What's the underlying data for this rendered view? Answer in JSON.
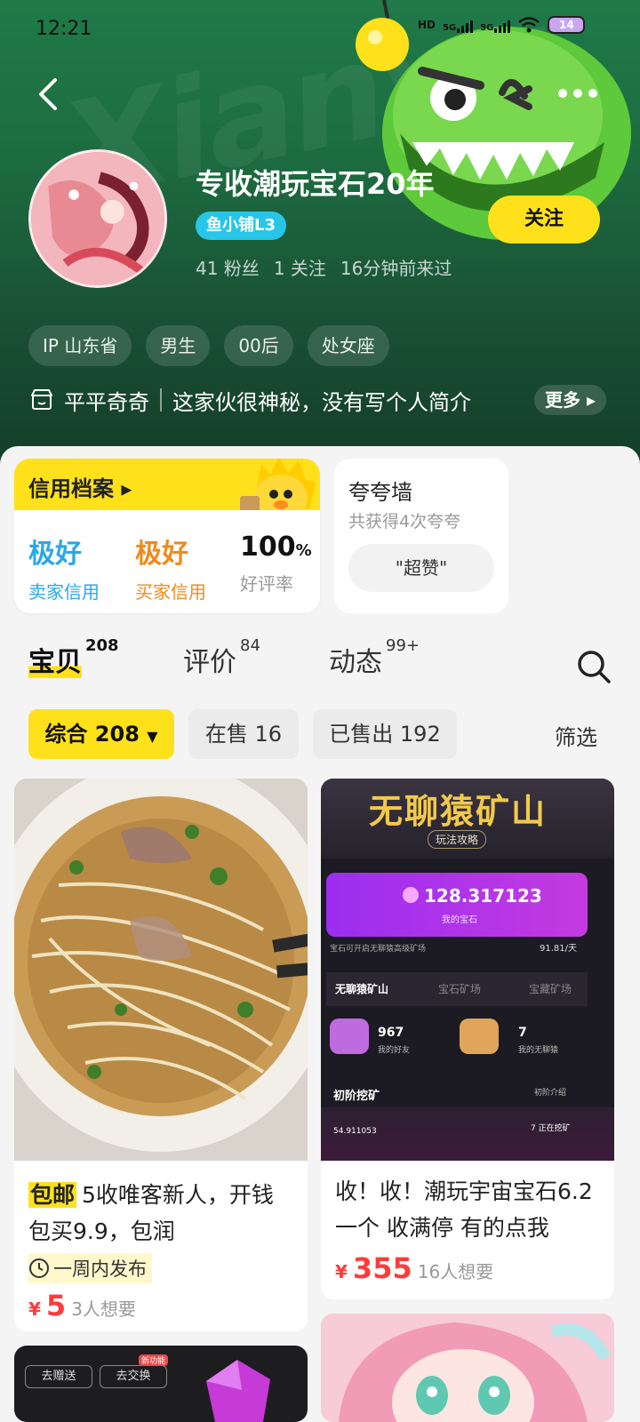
{
  "status_bar": {
    "time": "12:21",
    "battery": "14",
    "network": [
      "HD",
      "5G",
      "5G"
    ]
  },
  "header": {
    "shop_name": "专收潮玩宝石20年",
    "level_badge": "鱼小铺L3",
    "stats": {
      "fans": "41 粉丝",
      "following": "1 关注",
      "last_visit": "16分钟前来过"
    },
    "follow_label": "关注",
    "tags": [
      "IP 山东省",
      "男生",
      "00后",
      "处女座"
    ],
    "bio": {
      "nickname": "平平奇奇",
      "text": "这家伙很神秘，没有写个人简介",
      "more_label": "更多"
    }
  },
  "credit": {
    "title": "信用档案",
    "seller": {
      "value": "极好",
      "label": "卖家信用"
    },
    "buyer": {
      "value": "极好",
      "label": "买家信用"
    },
    "rating": {
      "value": "100",
      "unit": "%",
      "label": "好评率"
    }
  },
  "praise_wall": {
    "title": "夸夸墙",
    "subtitle": "共获得4次夸夸",
    "chip": "\"超赞\""
  },
  "tabs": [
    {
      "label": "宝贝",
      "count": "208",
      "active": true
    },
    {
      "label": "评价",
      "count": "84",
      "active": false
    },
    {
      "label": "动态",
      "count": "99+",
      "active": false
    }
  ],
  "filters": [
    {
      "label": "综合 208",
      "active": true
    },
    {
      "label": "在售 16",
      "active": false
    },
    {
      "label": "已售出 192",
      "active": false
    }
  ],
  "filter_link": "筛选",
  "products": [
    {
      "tag": "包邮",
      "title": "5收唯客新人，开钱包买9.9，包润",
      "published": "一周内发布",
      "price": "5",
      "want": "3人想要"
    },
    {
      "tag": "",
      "title": "收！收！潮玩宇宙宝石6.2一个 收满停 有的点我",
      "published": "",
      "price": "355",
      "want": "16人想要"
    }
  ],
  "screenshot_text": {
    "game_title": "无聊猿矿山",
    "game_subtitle": "玩法攻略",
    "gem_value": "128.317123",
    "gem_label": "我的宝石",
    "rate": "91.81/天",
    "tabs": [
      "无聊猿矿山",
      "宝石矿场",
      "宝藏矿场"
    ],
    "friends": "967",
    "friends_label": "我的好友",
    "apes": "7",
    "apes_label": "我的无聊猿",
    "section": "初阶挖矿",
    "section_link": "初阶介绍",
    "total": "54.911053",
    "mining": "7 正在挖矿",
    "mining_note": "宝石可开启无聊猿高级矿场",
    "teaser_buttons": [
      "去赠送",
      "去交换"
    ],
    "teaser_badge": "新功能"
  },
  "colors": {
    "accent_yellow": "#ffe11b",
    "header_green": "#1d6b40",
    "price_red": "#ff3b3b",
    "seller_blue": "#2aa8e8",
    "buyer_orange": "#f08a1c"
  }
}
